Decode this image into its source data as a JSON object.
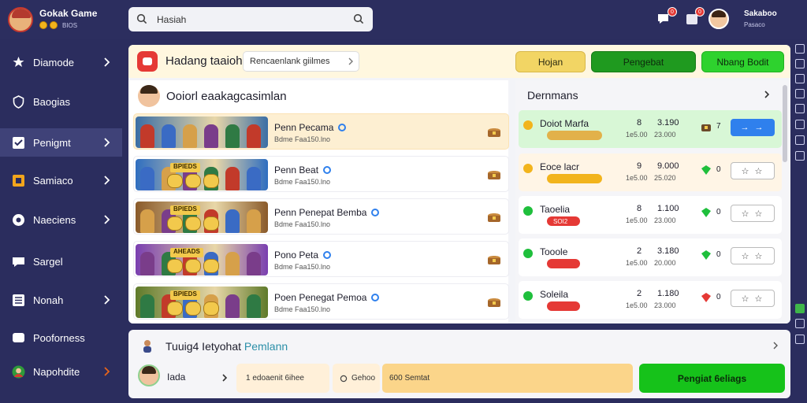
{
  "brand": {
    "title": "Gokak Game",
    "sub": "BIOS"
  },
  "search": {
    "value": "Hasiah"
  },
  "notifications": [
    {
      "icon": "chat-icon",
      "count": "0"
    },
    {
      "icon": "inbox-icon",
      "count": "0"
    }
  ],
  "user": {
    "name": "Sakaboo",
    "sub": "Pasaco"
  },
  "sidebar": {
    "items": [
      {
        "label": "Diamode",
        "icon": "star-icon",
        "chevron": true,
        "active": false
      },
      {
        "label": "Baogias",
        "icon": "shield-icon",
        "chevron": false,
        "active": false
      },
      {
        "label": "Penigmt",
        "icon": "check-square-icon",
        "chevron": true,
        "active": true
      },
      {
        "label": "Samiaco",
        "icon": "square-icon",
        "chevron": true,
        "active": false
      },
      {
        "label": "Naeciens",
        "icon": "circle-icon",
        "chevron": true,
        "active": false
      },
      {
        "label": "Sargel",
        "icon": "chat-icon",
        "chevron": false,
        "active": false
      },
      {
        "label": "Nonah",
        "icon": "list-icon",
        "chevron": true,
        "active": false
      },
      {
        "label": "Pooforness",
        "icon": "message-icon",
        "chevron": false,
        "active": false
      },
      {
        "label": "Napohdite",
        "icon": "avatar-icon",
        "chevron": true,
        "active": false
      }
    ]
  },
  "header": {
    "title": "Hadang taaioh",
    "filter_value": "Rencaenlank giilmes",
    "buttons": [
      {
        "label": "Hojan",
        "bg": "#f2d564",
        "fg": "#2a2a10",
        "border": "#d8b84a"
      },
      {
        "label": "Pengebat",
        "bg": "#1f9a1f",
        "fg": "#0d2a0d",
        "border": "#167a16"
      },
      {
        "label": "Nbang Bodit",
        "bg": "#2ed22e",
        "fg": "#0d2a0d",
        "border": "#22b022"
      }
    ]
  },
  "games_panel": {
    "title": "Ooiorl eaakagcasimlan",
    "games": [
      {
        "name": "Penn Pecama",
        "sub": "Bdme Faa150.lno",
        "highlight": true,
        "banner_label": "",
        "banner_bg": "#3b6ea5"
      },
      {
        "name": "Penn Beat",
        "sub": "Bdme Faa150.lno",
        "highlight": false,
        "banner_label": "BPIEDS",
        "banner_bg": "#2f6ec0"
      },
      {
        "name": "Penn Penepat Bemba",
        "sub": "Bdme Faa150.lno",
        "highlight": false,
        "banner_label": "BPIEDS",
        "banner_bg": "#8a5a2a"
      },
      {
        "name": "Pono Peta",
        "sub": "Bdme Faa150.lno",
        "highlight": false,
        "banner_label": "AHEADS",
        "banner_bg": "#7a3fb0"
      },
      {
        "name": "Poen Penegat Pemoa",
        "sub": "Bdme Faa150.lno",
        "highlight": false,
        "banner_label": "BPIEDS",
        "banner_bg": "#5f7a2a"
      }
    ]
  },
  "ranking": {
    "title": "Dernmans",
    "rows": [
      {
        "name": "Doiot Marfa",
        "tag": "",
        "rank": "8",
        "score": "3.190",
        "sub1": "1e5.00",
        "sub2": "23.000",
        "count": "7",
        "button": "→ →",
        "bg": "green",
        "dot": "#f2b41c",
        "tag_color": "#e2b14a",
        "icon": "chest-icon",
        "btn_bg": "#2f80ed",
        "btn_fg": "#fff"
      },
      {
        "name": "Eoce lacr",
        "tag": "",
        "rank": "9",
        "score": "9.000",
        "sub1": "1e5.00",
        "sub2": "25.020",
        "count": "0",
        "button": "☆ ☆",
        "bg": "cream",
        "dot": "#f2b41c",
        "tag_color": "#f2b41c",
        "icon": "gem-icon",
        "btn_bg": "#fff",
        "btn_fg": "#444"
      },
      {
        "name": "Taoelia",
        "tag": "SOI2",
        "rank": "8",
        "score": "1.100",
        "sub1": "1e5.00",
        "sub2": "23.000",
        "count": "0",
        "button": "☆ ☆",
        "bg": "white",
        "dot": "#1fbf3c",
        "tag_color": "#e53935",
        "icon": "gem-icon",
        "btn_bg": "#fff",
        "btn_fg": "#444"
      },
      {
        "name": "Tooole",
        "tag": "",
        "rank": "2",
        "score": "3.180",
        "sub1": "1e5.00",
        "sub2": "20.000",
        "count": "0",
        "button": "☆ ☆",
        "bg": "white",
        "dot": "#1fbf3c",
        "tag_color": "#e53935",
        "icon": "gem-icon",
        "btn_bg": "#fff",
        "btn_fg": "#444"
      },
      {
        "name": "Soleila",
        "tag": "",
        "rank": "2",
        "score": "1.180",
        "sub1": "1e5.00",
        "sub2": "23.000",
        "count": "0",
        "button": "☆ ☆",
        "bg": "white",
        "dot": "#1fbf3c",
        "tag_color": "#e53935",
        "icon": "ruby-icon",
        "btn_bg": "#fff",
        "btn_fg": "#444"
      }
    ]
  },
  "bottom": {
    "title_main": "Tuuig4 Ietyohat ",
    "title_highlight": "Pemlann",
    "user_label": "Iada",
    "field1": "1 edoaenit 6ihee",
    "field2": "Gehoo",
    "field3": "600 Semtat",
    "cta": "Pengiat 6eliags"
  }
}
